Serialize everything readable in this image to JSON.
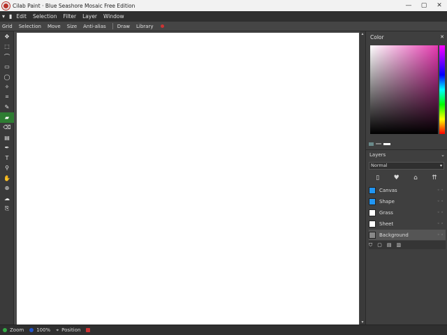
{
  "titlebar": {
    "title": "Cilab Paint · Blue Seashore Mosaic Free Edition",
    "min": "—",
    "max": "▢",
    "close": "✕"
  },
  "menubar": {
    "items": [
      "Edit",
      "Selection",
      "Filter",
      "Layer",
      "Window"
    ]
  },
  "optbar": {
    "items": [
      "Grid",
      "Selection",
      "Move",
      "Size",
      "Anti-alias",
      "Draw",
      "Library"
    ]
  },
  "tools": [
    {
      "name": "move-tool",
      "glyph": "✥",
      "active": false
    },
    {
      "name": "select-tool",
      "glyph": "⬚",
      "active": false
    },
    {
      "name": "lasso-tool",
      "glyph": "⌒",
      "active": false
    },
    {
      "name": "rect-tool",
      "glyph": "▭",
      "active": false
    },
    {
      "name": "ellipse-tool",
      "glyph": "◯",
      "active": false
    },
    {
      "name": "magic-wand-tool",
      "glyph": "✧",
      "active": false
    },
    {
      "name": "crop-tool",
      "glyph": "⌗",
      "active": false
    },
    {
      "name": "brush-tool",
      "glyph": "✎",
      "active": false
    },
    {
      "name": "fill-tool",
      "glyph": "▰",
      "active": true
    },
    {
      "name": "eraser-tool",
      "glyph": "⌫",
      "active": false
    },
    {
      "name": "gradient-tool",
      "glyph": "▤",
      "active": false
    },
    {
      "name": "pen-tool",
      "glyph": "✒",
      "active": false
    },
    {
      "name": "text-tool",
      "glyph": "T",
      "active": false
    },
    {
      "name": "eyedropper-tool",
      "glyph": "⚲",
      "active": false
    },
    {
      "name": "hand-tool",
      "glyph": "✋",
      "active": false
    },
    {
      "name": "zoom-tool",
      "glyph": "⊕",
      "active": false
    },
    {
      "name": "smudge-tool",
      "glyph": "☁",
      "active": false
    },
    {
      "name": "clone-tool",
      "glyph": "⎘",
      "active": false
    }
  ],
  "color_panel": {
    "title": "Color",
    "close": "✕"
  },
  "layers": {
    "title": "Layers",
    "blend_mode": "Normal",
    "rows": [
      {
        "label": "Canvas",
        "color": "#2196f3",
        "selected": false
      },
      {
        "label": "Shape",
        "color": "#2196f3",
        "selected": false
      },
      {
        "label": "Grass",
        "color": "#ffffff",
        "selected": false
      },
      {
        "label": "Sheet",
        "color": "#ffffff",
        "selected": false
      },
      {
        "label": "Background",
        "color": "#888888",
        "selected": true
      }
    ]
  },
  "status": {
    "zoom": "Zoom",
    "size": "100%",
    "pos": "Position"
  },
  "colors": {
    "accent": "#2e7d32",
    "brand": "#b8322b",
    "canvas": "#ffffff"
  }
}
